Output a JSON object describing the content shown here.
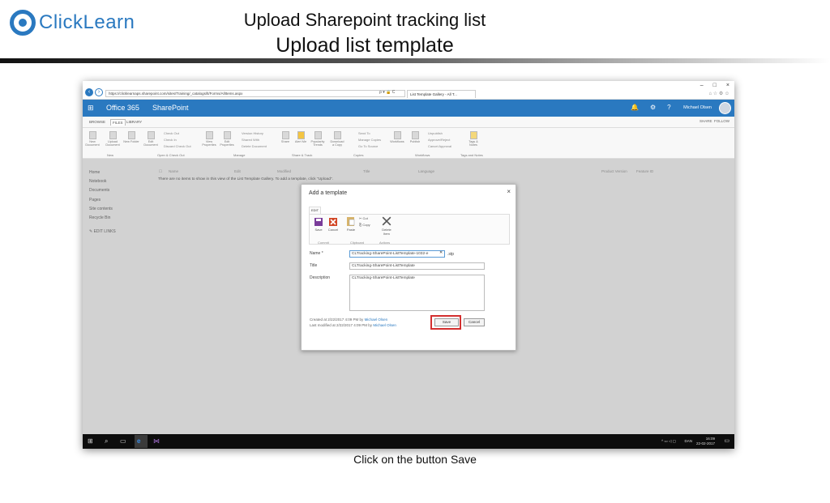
{
  "brand": {
    "name": "ClickLearn"
  },
  "slide": {
    "title_line1": "Upload Sharepoint tracking list",
    "title_line2": "Upload list template",
    "caption": "Click on the button Save"
  },
  "browser": {
    "address": "https://clicklearnaps.sharepoint.com/sites/Training/_catalogs/lt/Forms/AllItems.aspx",
    "address_icons": "ρ ▾ 🔒 C",
    "tab_title": "List Template Gallery - All T...",
    "window_controls": [
      "–",
      "□",
      "×"
    ]
  },
  "suite": {
    "app_launcher": "⊞",
    "office": "Office 365",
    "app": "SharePoint",
    "user": "Michael Olsen",
    "icons": [
      "bell-icon",
      "gear-icon",
      "help-icon"
    ]
  },
  "ribbon": {
    "tabs": [
      "BROWSE",
      "FILES",
      "LIBRARY"
    ],
    "share": "SHARE",
    "follow": "FOLLOW",
    "buttons": [
      "New Document",
      "Upload Document",
      "New Folder",
      "Edit Document",
      "View Properties",
      "Edit Properties",
      "Share",
      "Alert Me",
      "Popularity Trends",
      "Download a Copy",
      "Workflows",
      "Publish",
      "Tags & Notes"
    ],
    "small_buttons": [
      "Check Out",
      "Check In",
      "Discard Check Out",
      "Version History",
      "Shared With",
      "Delete Document",
      "Send To",
      "Manage Copies",
      "Go To Source",
      "Unpublish",
      "Approve/Reject",
      "Cancel Approval"
    ],
    "groups": [
      "New",
      "Open & Check Out",
      "Manage",
      "Share & Track",
      "Copies",
      "Workflows",
      "Tags and Notes"
    ]
  },
  "left_nav": [
    "Home",
    "Notebook",
    "Documents",
    "Pages",
    "Site contents",
    "Recycle Bin",
    "EDIT LINKS"
  ],
  "columns": [
    "Name",
    "Edit",
    "Modified",
    "Title",
    "Language",
    "Product Version",
    "Feature ID"
  ],
  "empty_message": "There are no items to show in this view of the List Template Gallery. To add a template, click \"Upload\".",
  "dialog": {
    "title": "Add a template",
    "close": "×",
    "edit_tab": "EDIT",
    "buttons": {
      "save": "Save",
      "cancel": "Cancel",
      "paste": "Paste",
      "cut": "Cut",
      "copy": "Copy",
      "delete_item": "Delete Item"
    },
    "groups": {
      "commit": "Commit",
      "clipboard": "Clipboard",
      "actions": "Actions"
    },
    "fields": {
      "name_label": "Name *",
      "name_value": "CLTracking-SharePoint-ListTemplate-1032-e",
      "name_suffix": ".stp",
      "title_label": "Title",
      "title_value": "CLTracking-SharePoint-ListTemplate",
      "description_label": "Description",
      "description_value": "CLTracking-SharePoint-ListTemplate"
    },
    "created": "Created at 2/22/2017 4:09 PM  by",
    "modified": "Last modified at 2/22/2017 4:09 PM  by",
    "created_by": "Michael Olsen",
    "modified_by": "Michael Olsen",
    "save_button": "Save",
    "cancel_button": "Cancel"
  },
  "taskbar": {
    "lang": "DAN",
    "time": "16:09",
    "date": "22-02-2017"
  },
  "colors": {
    "brand": "#2a79c0",
    "highlight": "#d32f2f"
  }
}
